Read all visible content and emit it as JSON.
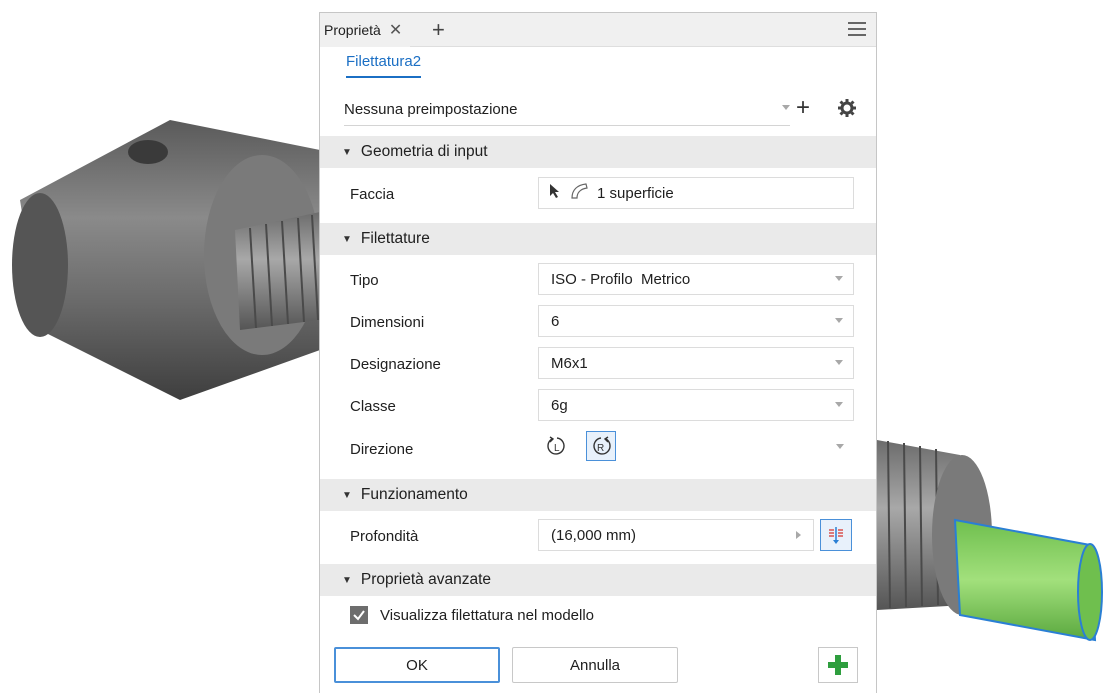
{
  "panel": {
    "tab_label": "Proprietà",
    "feature_name": "Filettatura2",
    "preset_value": "Nessuna preimpostazione"
  },
  "sections": {
    "input_geometry": "Geometria di input",
    "threads": "Filettature",
    "behavior": "Funzionamento",
    "advanced": "Proprietà avanzate"
  },
  "fields": {
    "face": {
      "label": "Faccia",
      "value": "1 superficie"
    },
    "type": {
      "label": "Tipo",
      "value": "ISO - Profilo  Metrico"
    },
    "size": {
      "label": "Dimensioni",
      "value": "6"
    },
    "designation": {
      "label": "Designazione",
      "value": "M6x1"
    },
    "class": {
      "label": "Classe",
      "value": "6g"
    },
    "direction": {
      "label": "Direzione",
      "selected": "right-hand"
    },
    "depth": {
      "label": "Profondità",
      "value": "(16,000 mm)"
    }
  },
  "advanced": {
    "display_thread_label": "Visualizza filettatura nel modello",
    "display_thread_checked": true
  },
  "buttons": {
    "ok": "OK",
    "cancel": "Annulla"
  },
  "icons": {
    "tab_close": "close-icon",
    "tab_add": "plus-icon",
    "menu": "hamburger-icon",
    "preset_add": "plus-icon",
    "preset_settings": "gear-icon",
    "select": "cursor-arrow-icon",
    "surface": "surface-icon",
    "left_hand": "left-hand-thread-icon",
    "right_hand": "right-hand-thread-icon",
    "depth_direction": "flip-depth-icon",
    "apply": "apply-plus-icon"
  },
  "colors": {
    "accent": "#1b6fc4",
    "section_bg": "#eaeaea",
    "apply_green": "#2e9e3e",
    "model_body": "#6e6e6e",
    "thread_highlight": "#8cd36a"
  }
}
